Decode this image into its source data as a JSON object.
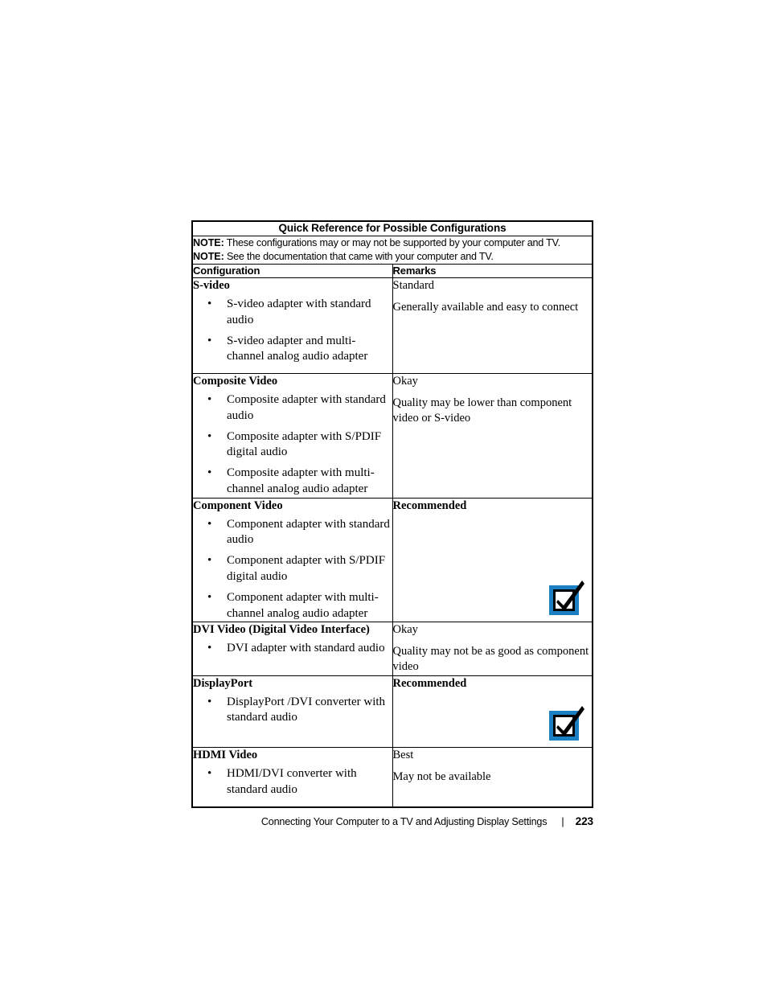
{
  "table": {
    "title": "Quick Reference for Possible Configurations",
    "notes": [
      {
        "label": "NOTE:",
        "text": " These configurations may or may not be supported by your computer and TV."
      },
      {
        "label": "NOTE:",
        "text": " See the documentation that came with your computer and TV."
      }
    ],
    "columns": {
      "configuration": "Configuration",
      "remarks": "Remarks"
    },
    "rows": [
      {
        "id": "s-video",
        "config_title": "S-video",
        "bullets": [
          "S-video adapter with standard audio",
          "S-video adapter and multi-channel analog audio adapter"
        ],
        "remark_heading": "Standard",
        "remark_heading_bold": false,
        "remark_body": "Generally available and easy to connect",
        "check_icon": false
      },
      {
        "id": "composite-video",
        "config_title": "Composite Video",
        "bullets": [
          "Composite adapter with standard audio",
          "Composite adapter with S/PDIF digital audio",
          "Composite adapter with multi-channel analog audio adapter"
        ],
        "remark_heading": "Okay",
        "remark_heading_bold": false,
        "remark_body": "Quality may be lower than component video or S-video",
        "check_icon": false
      },
      {
        "id": "component-video",
        "config_title": "Component Video",
        "bullets": [
          "Component adapter with standard audio",
          "Component adapter with S/PDIF digital audio",
          "Component adapter with multi-channel analog audio adapter"
        ],
        "remark_heading": "Recommended",
        "remark_heading_bold": true,
        "remark_body": "",
        "check_icon": true
      },
      {
        "id": "dvi-video",
        "config_title": "DVI Video (Digital Video Interface)",
        "bullets": [
          "DVI adapter with standard audio"
        ],
        "remark_heading": "Okay",
        "remark_heading_bold": false,
        "remark_body": "Quality may not be as good as component video",
        "check_icon": false
      },
      {
        "id": "displayport",
        "config_title": "DisplayPort",
        "bullets": [
          "DisplayPort /DVI converter with standard audio"
        ],
        "remark_heading": "Recommended",
        "remark_heading_bold": true,
        "remark_body": "",
        "check_icon": true
      },
      {
        "id": "hdmi-video",
        "config_title": "HDMI Video",
        "bullets": [
          "HDMI/DVI converter with standard audio"
        ],
        "remark_heading": "Best",
        "remark_heading_bold": false,
        "remark_body": "May not be available",
        "check_icon": false
      }
    ],
    "bullet_glyph": "•"
  },
  "footer": {
    "title": "Connecting Your Computer to a TV and Adjusting Display Settings",
    "separator": "|",
    "page_number": "223"
  },
  "colors": {
    "check_icon_blue": "#1b7fc4",
    "check_icon_black": "#000000",
    "check_icon_white": "#ffffff",
    "rule": "#000000",
    "text": "#000000",
    "page_background": "#ffffff"
  }
}
